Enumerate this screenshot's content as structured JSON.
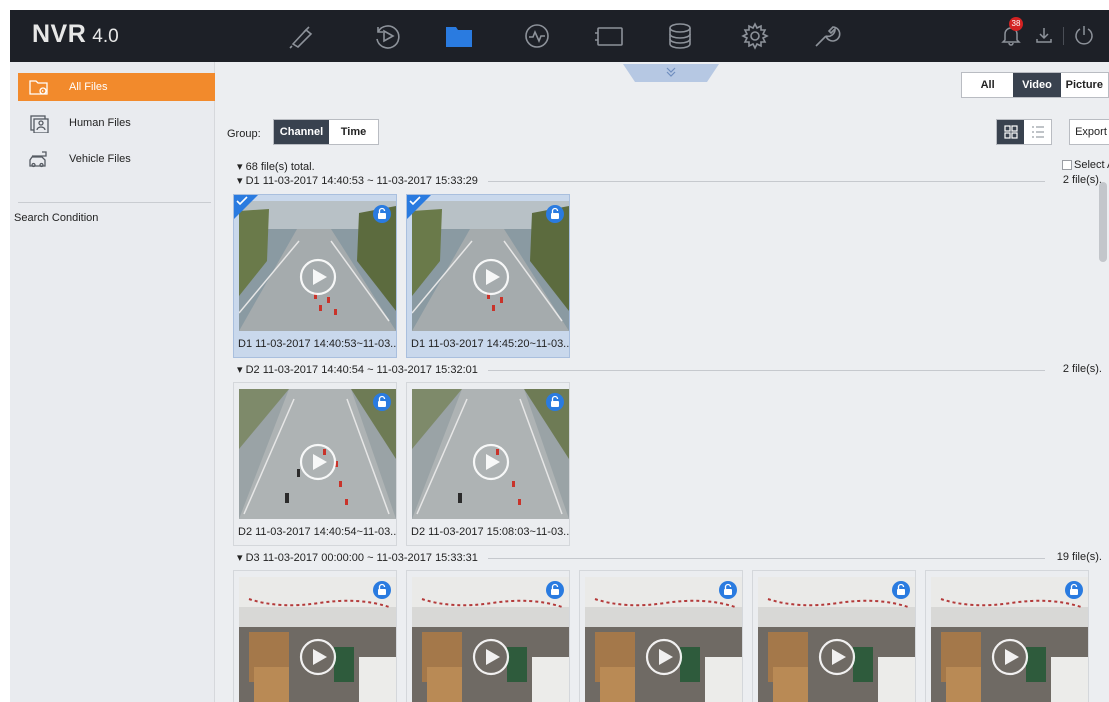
{
  "app": {
    "brand": "NVR",
    "version": "4.0",
    "notification_count": "38",
    "nav_icons": [
      "live-view-icon",
      "playback-icon",
      "file-management-icon",
      "smart-analysis-icon",
      "camera-icon",
      "storage-icon",
      "system-settings-icon",
      "maintenance-icon"
    ],
    "active_nav": "file-management-icon",
    "accent_color": "#f28a2c",
    "selection_color": "#2a7be0"
  },
  "sidebar": {
    "items": [
      {
        "label": "All Files",
        "icon": "folder-icon",
        "active": true
      },
      {
        "label": "Human Files",
        "icon": "human-icon",
        "active": false
      },
      {
        "label": "Vehicle Files",
        "icon": "vehicle-icon",
        "active": false
      }
    ],
    "search_condition": "Search Condition"
  },
  "filter": {
    "type_tabs": [
      "All",
      "Video",
      "Picture"
    ],
    "active_type": "Video",
    "group_label": "Group:",
    "group_tabs": [
      "Channel",
      "Time"
    ],
    "active_group": "Channel",
    "export_label": "Export",
    "total": "68 file(s) total.",
    "select_all": "Select A"
  },
  "groups": [
    {
      "title": "D1 11-03-2017 14:40:53 ~ 11-03-2017 15:33:29",
      "count": "2 file(s).",
      "files": [
        {
          "caption": "D1 11-03-2017 14:40:53~11-03...",
          "selected": true
        },
        {
          "caption": "D1 11-03-2017 14:45:20~11-03...",
          "selected": true
        }
      ]
    },
    {
      "title": "D2 11-03-2017 14:40:54 ~ 11-03-2017 15:32:01",
      "count": "2 file(s).",
      "files": [
        {
          "caption": "D2 11-03-2017 14:40:54~11-03...",
          "selected": false
        },
        {
          "caption": "D2 11-03-2017 15:08:03~11-03...",
          "selected": false
        }
      ]
    },
    {
      "title": "D3 11-03-2017 00:00:00 ~ 11-03-2017 15:33:31",
      "count": "19 file(s).",
      "files": [
        {
          "caption": "",
          "selected": false
        },
        {
          "caption": "",
          "selected": false
        },
        {
          "caption": "",
          "selected": false
        },
        {
          "caption": "",
          "selected": false
        },
        {
          "caption": "",
          "selected": false
        }
      ]
    }
  ]
}
